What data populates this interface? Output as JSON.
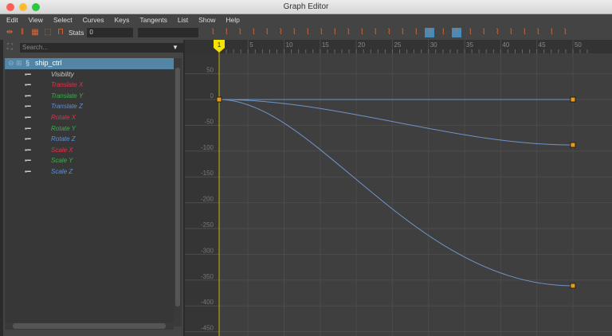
{
  "window": {
    "title": "Graph Editor"
  },
  "menu": [
    "Edit",
    "View",
    "Select",
    "Curves",
    "Keys",
    "Tangents",
    "List",
    "Show",
    "Help"
  ],
  "toolbar": {
    "stats_label": "Stats",
    "stats_value": "0",
    "second_field": ""
  },
  "outliner": {
    "search_placeholder": "Search...",
    "object": "ship_ctrl",
    "channels": [
      {
        "label": "Visibility",
        "color": "#c8c8c8"
      },
      {
        "label": "Translate X",
        "color": "#e0324b"
      },
      {
        "label": "Translate Y",
        "color": "#38b049"
      },
      {
        "label": "Translate Z",
        "color": "#5b8fd9"
      },
      {
        "label": "Rotate X",
        "color": "#e0324b"
      },
      {
        "label": "Rotate Y",
        "color": "#38b049"
      },
      {
        "label": "Rotate Z",
        "color": "#5b8fd9"
      },
      {
        "label": "Scale X",
        "color": "#e0324b"
      },
      {
        "label": "Scale Y",
        "color": "#38b049"
      },
      {
        "label": "Scale Z",
        "color": "#5b8fd9"
      }
    ]
  },
  "graph": {
    "current_frame": "1",
    "x_ticks": [
      "5",
      "10",
      "15",
      "20",
      "25",
      "30",
      "35",
      "40",
      "45",
      "50"
    ],
    "y_ticks": [
      "50",
      "0",
      "-50",
      "-100",
      "-150",
      "-200",
      "-250",
      "-300",
      "-350",
      "-400",
      "-450"
    ],
    "curve_color": "#6f94c9",
    "key_color": "#e89a1c",
    "curves": [
      {
        "start": 0,
        "end": 0
      },
      {
        "start": 0,
        "end": -88
      },
      {
        "start": 0,
        "end": -361
      }
    ]
  }
}
